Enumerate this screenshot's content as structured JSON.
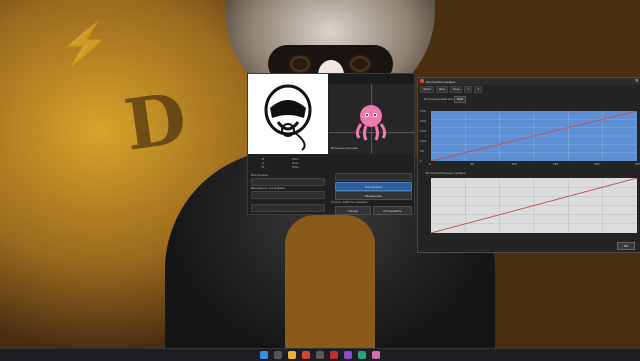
{
  "curve_window": {
    "title": "Настройка кривых",
    "menu": [
      "Файл",
      "Вид",
      "Вид",
      "1",
      "2"
    ],
    "input_label": "Используемый вход",
    "input_value": "RGB",
    "chart1_xticks": [
      "0",
      "50",
      "100",
      "150",
      "200",
      "250"
    ],
    "chart1_yticks": [
      "250",
      "200",
      "150",
      "100",
      "50",
      "0"
    ],
    "chart2_label": "Исполнительные кривые",
    "ok": "OK"
  },
  "app_window": {
    "section_input": "Входные данные",
    "section_settings": "Настройки",
    "section_output": "Выходной интерфейс",
    "left_col": [
      "R",
      "G",
      "B"
    ],
    "right_col": [
      "Пик",
      "Ном",
      "Мин"
    ],
    "settings_button": "Настройки",
    "apply_button": "Применить",
    "status_label": "Статус работы камеры",
    "bottom_buttons": [
      "Назад",
      "Остановить"
    ]
  },
  "chart_data": [
    {
      "type": "line",
      "title": "",
      "xlim": [
        0,
        255
      ],
      "ylim": [
        0,
        255
      ],
      "grid": true,
      "series": [
        {
          "x": [
            0,
            255
          ],
          "y": [
            0,
            255
          ],
          "color": "#d04a4a"
        }
      ]
    },
    {
      "type": "line",
      "title": "Исполнительные кривые",
      "xlim": [
        0,
        255
      ],
      "ylim": [
        0,
        255
      ],
      "grid": true,
      "series": [
        {
          "x": [
            0,
            255
          ],
          "y": [
            0,
            255
          ],
          "color": "#c04a4a"
        }
      ]
    }
  ],
  "colors": {
    "accent": "#2f5f9a",
    "plot_blue": "#5d8fd4",
    "curve_red": "#d04a4a"
  }
}
